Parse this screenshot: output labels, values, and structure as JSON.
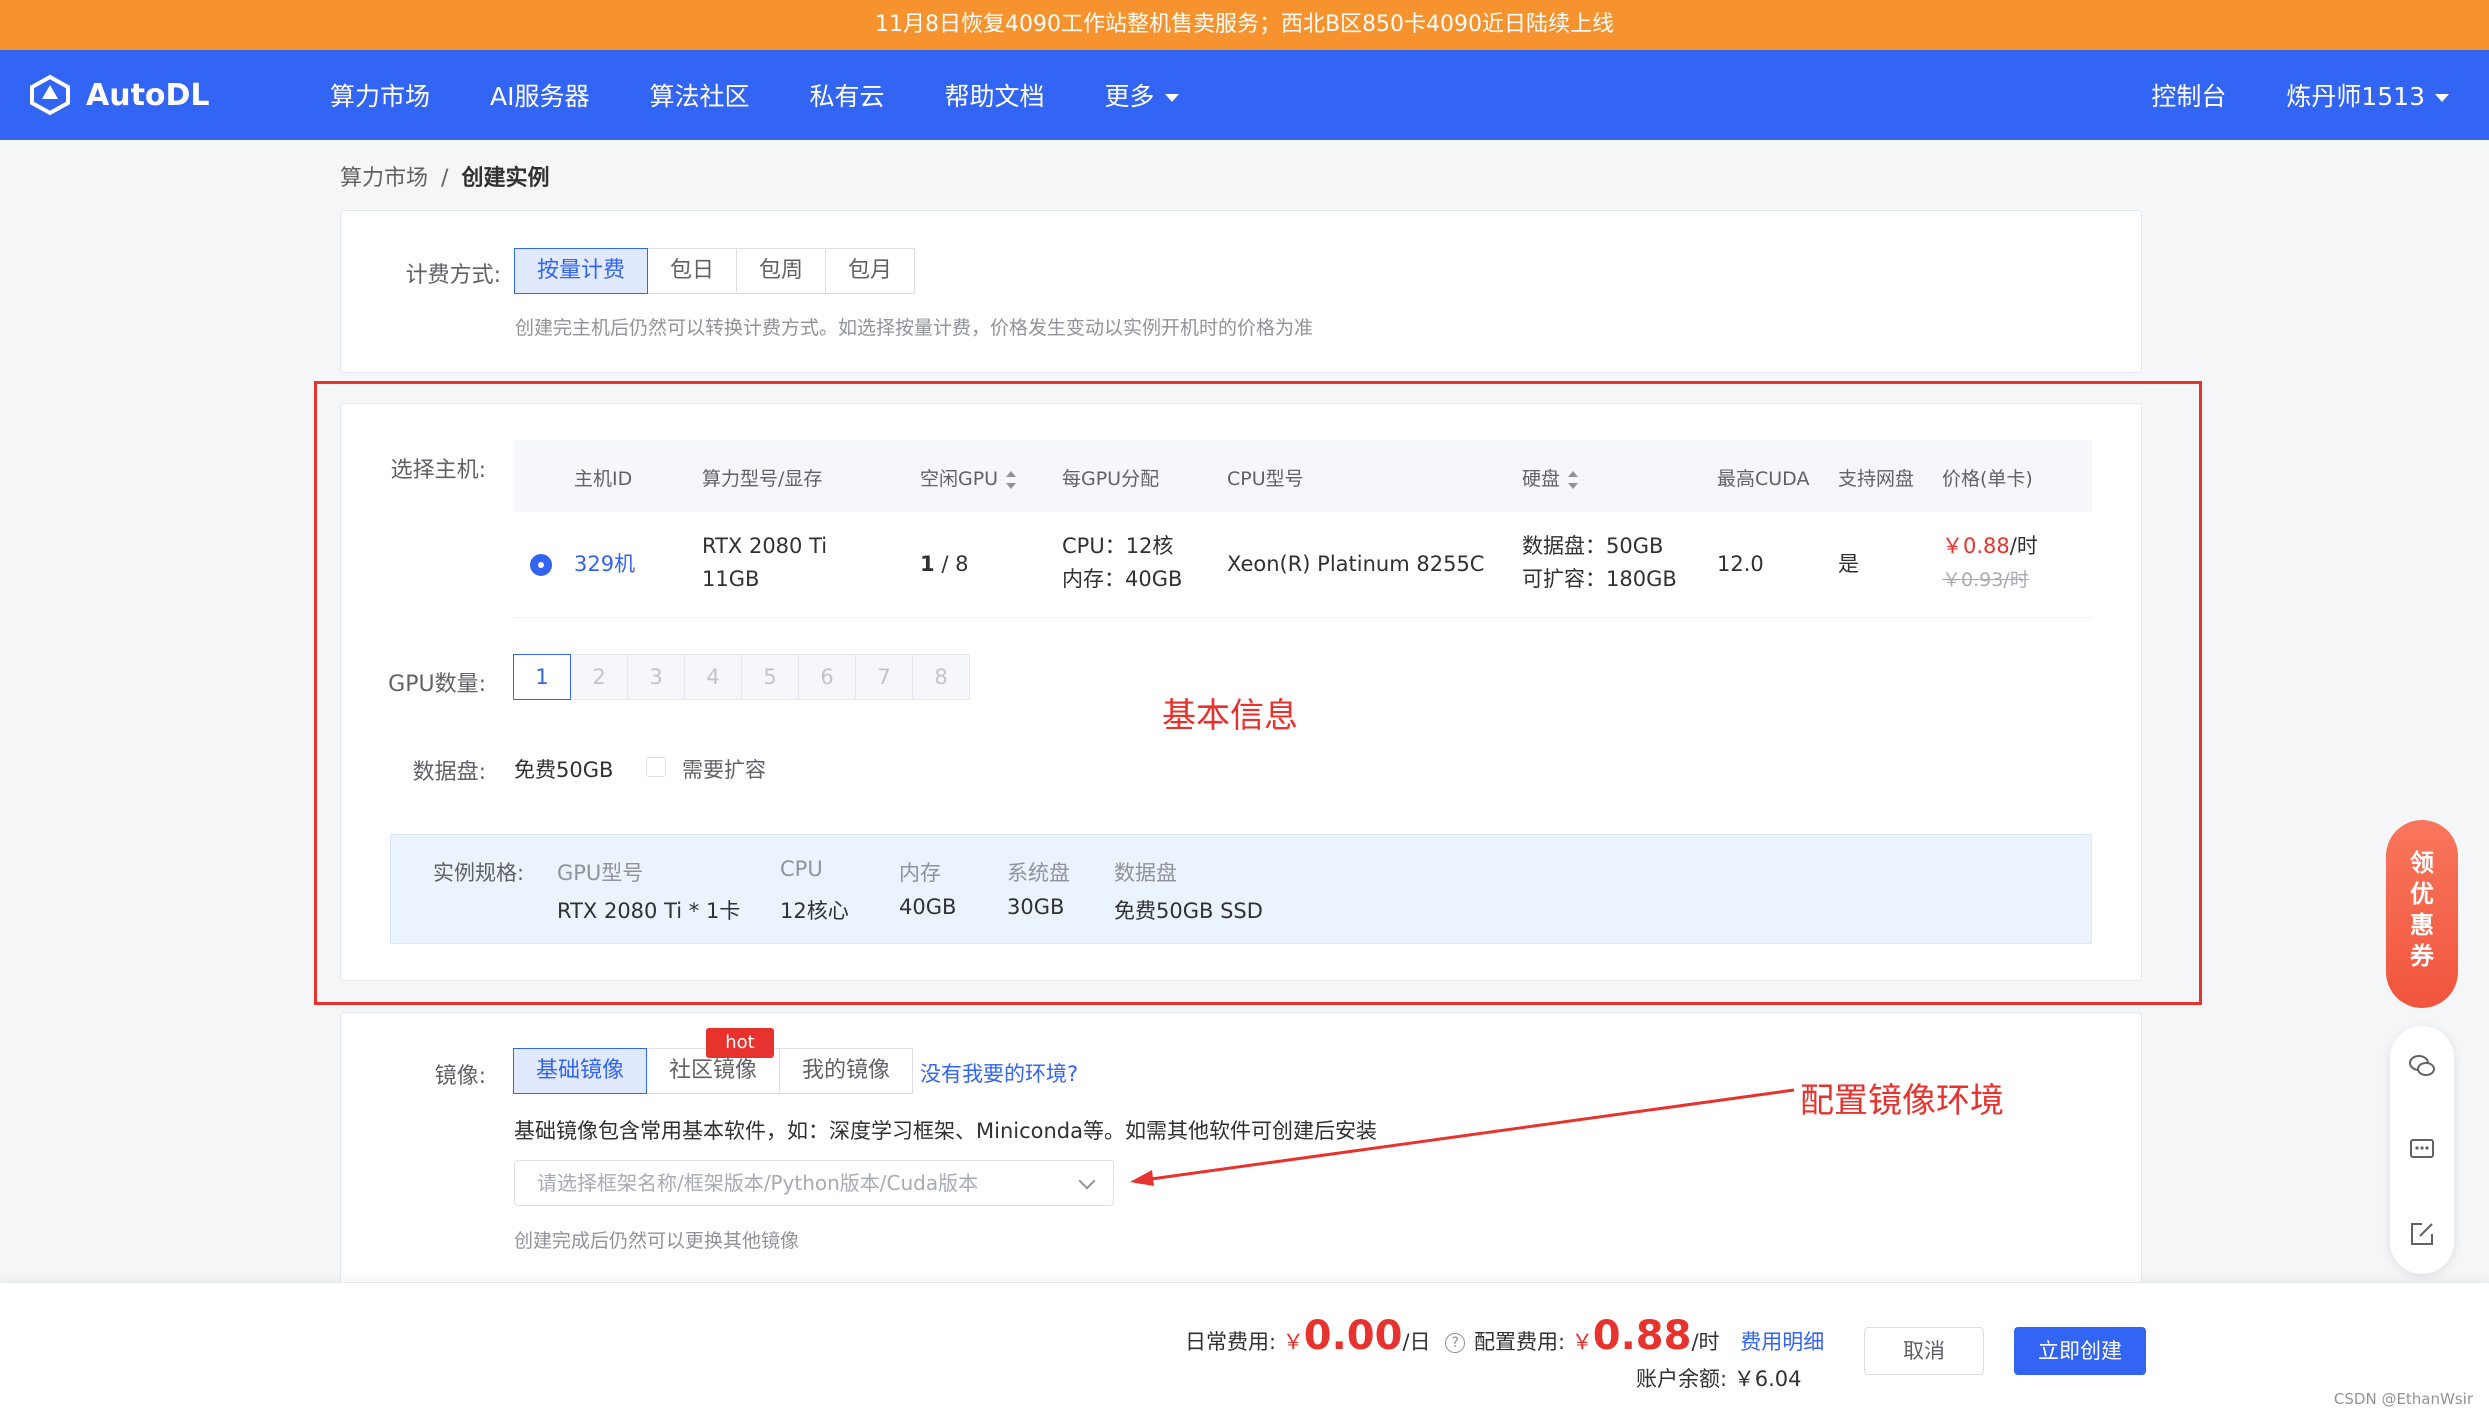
{
  "banner": {
    "text": "11月8日恢复4090工作站整机售卖服务；西北B区850卡4090近日陆续上线"
  },
  "nav": {
    "brand": "AutoDL",
    "items": [
      "算力市场",
      "AI服务器",
      "算法社区",
      "私有云",
      "帮助文档",
      "更多"
    ],
    "console": "控制台",
    "user": "炼丹师1513"
  },
  "breadcrumb": {
    "parent": "算力市场",
    "sep": "/",
    "current": "创建实例"
  },
  "billing": {
    "label": "计费方式:",
    "options": [
      "按量计费",
      "包日",
      "包周",
      "包月"
    ],
    "selected": "按量计费",
    "hint": "创建完主机后仍然可以转换计费方式。如选择按量计费，价格发生变动以实例开机时的价格为准"
  },
  "host": {
    "label": "选择主机:",
    "columns": [
      "主机ID",
      "算力型号/显存",
      "空闲GPU",
      "每GPU分配",
      "CPU型号",
      "硬盘",
      "最高CUDA",
      "支持网盘",
      "价格(单卡)"
    ],
    "row": {
      "id": "329机",
      "gpu_model": "RTX 2080 Ti",
      "gpu_mem": "11GB",
      "free_gpu": "1",
      "total_gpu": "/ 8",
      "cpu_alloc": "CPU：12核",
      "mem_alloc": "内存：40GB",
      "cpu_model": "Xeon(R) Platinum 8255C",
      "disk": "数据盘：50GB",
      "disk_ext": "可扩容：180GB",
      "cuda": "12.0",
      "netdisk": "是",
      "price": "￥0.88",
      "price_unit": "/时",
      "price_orig": "￥0.93/时"
    }
  },
  "gpu_count": {
    "label": "GPU数量:",
    "options": [
      "1",
      "2",
      "3",
      "4",
      "5",
      "6",
      "7",
      "8"
    ],
    "selected": "1"
  },
  "data_disk": {
    "label": "数据盘:",
    "free": "免费50GB",
    "expand": "需要扩容"
  },
  "spec": {
    "label": "实例规格:",
    "cols": [
      {
        "h": "GPU型号",
        "v": "RTX 2080 Ti * 1卡"
      },
      {
        "h": "CPU",
        "v": "12核心"
      },
      {
        "h": "内存",
        "v": "40GB"
      },
      {
        "h": "系统盘",
        "v": "30GB"
      },
      {
        "h": "数据盘",
        "v": "免费50GB SSD"
      }
    ]
  },
  "annotations": {
    "basic": "基本信息",
    "image": "配置镜像环境"
  },
  "image": {
    "label": "镜像:",
    "tabs": [
      "基础镜像",
      "社区镜像",
      "我的镜像"
    ],
    "hot": "hot",
    "missing_link": "没有我要的环境?",
    "desc": "基础镜像包含常用基本软件，如：深度学习框架、Miniconda等。如需其他软件可创建后安装",
    "placeholder": "请选择框架名称/框架版本/Python版本/Cuda版本",
    "hint": "创建完成后仍然可以更换其他镜像"
  },
  "footer": {
    "daily_label": "日常费用:",
    "daily_yen": "￥",
    "daily_value": "0.00",
    "daily_unit": "/日",
    "config_label": "配置费用:",
    "config_yen": "￥",
    "config_value": "0.88",
    "config_unit": "/时",
    "detail_link": "费用明细",
    "balance": "账户余额: ￥6.04",
    "cancel": "取消",
    "create": "立即创建",
    "watermark": "CSDN @EthanWsir"
  },
  "side": {
    "coupon": [
      "领",
      "优",
      "惠",
      "券"
    ]
  },
  "colors": {
    "primary": "#3365f4",
    "banner": "#f7932e",
    "danger": "#e8322d"
  }
}
